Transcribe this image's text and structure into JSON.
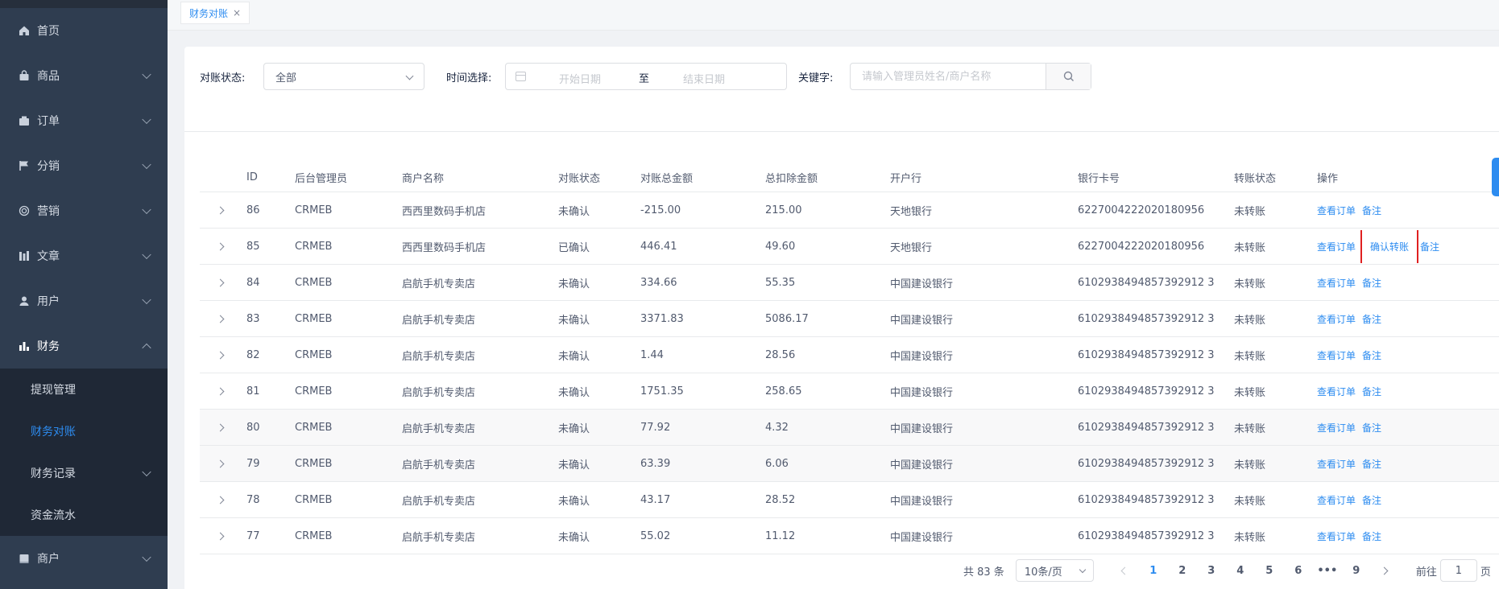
{
  "sidebar": {
    "items": [
      {
        "label": "首页",
        "icon": "home-icon",
        "has_arrow": false
      },
      {
        "label": "商品",
        "icon": "bag-icon",
        "has_arrow": true
      },
      {
        "label": "订单",
        "icon": "order-icon",
        "has_arrow": true
      },
      {
        "label": "分销",
        "icon": "flag-icon",
        "has_arrow": true
      },
      {
        "label": "营销",
        "icon": "target-icon",
        "has_arrow": true
      },
      {
        "label": "文章",
        "icon": "article-icon",
        "has_arrow": true
      },
      {
        "label": "用户",
        "icon": "user-icon",
        "has_arrow": true
      },
      {
        "label": "财务",
        "icon": "bar-chart-icon",
        "has_arrow": true,
        "open": true
      }
    ],
    "submenu": [
      {
        "label": "提现管理"
      },
      {
        "label": "财务对账",
        "active": true
      },
      {
        "label": "财务记录",
        "has_arrow": true
      },
      {
        "label": "资金流水"
      }
    ],
    "after": [
      {
        "label": "商户",
        "icon": "shop-icon",
        "has_arrow": true
      }
    ]
  },
  "tabs": [
    {
      "label": "财务对账",
      "close": "×"
    }
  ],
  "filters": {
    "state_label": "对账状态:",
    "state_value": "全部",
    "time_label": "时间选择:",
    "start_placeholder": "开始日期",
    "range_sep": "至",
    "end_placeholder": "结束日期",
    "keyword_label": "关键字:",
    "keyword_placeholder": "请输入管理员姓名/商户名称"
  },
  "table": {
    "headers": [
      "",
      "ID",
      "后台管理员",
      "商户名称",
      "对账状态",
      "对账总金额",
      "总扣除金额",
      "开户行",
      "银行卡号",
      "转账状态",
      "操作"
    ],
    "rows": [
      {
        "id": "86",
        "admin": "CRMEB",
        "shop": "西西里数码手机店",
        "state": "未确认",
        "total": "-215.00",
        "deduct": "215.00",
        "bank": "天地银行",
        "card": "6227004222020180956",
        "trans": "未转账",
        "ops": [
          "查看订单",
          "备注"
        ]
      },
      {
        "id": "85",
        "admin": "CRMEB",
        "shop": "西西里数码手机店",
        "state": "已确认",
        "total": "446.41",
        "deduct": "49.60",
        "bank": "天地银行",
        "card": "6227004222020180956",
        "trans": "未转账",
        "ops": [
          "查看订单",
          "确认转账",
          "备注"
        ],
        "highlight": 1
      },
      {
        "id": "84",
        "admin": "CRMEB",
        "shop": "启航手机专卖店",
        "state": "未确认",
        "total": "334.66",
        "deduct": "55.35",
        "bank": "中国建设银行",
        "card": "6102938494857392912 3",
        "trans": "未转账",
        "ops": [
          "查看订单",
          "备注"
        ]
      },
      {
        "id": "83",
        "admin": "CRMEB",
        "shop": "启航手机专卖店",
        "state": "未确认",
        "total": "3371.83",
        "deduct": "5086.17",
        "bank": "中国建设银行",
        "card": "6102938494857392912 3",
        "trans": "未转账",
        "ops": [
          "查看订单",
          "备注"
        ]
      },
      {
        "id": "82",
        "admin": "CRMEB",
        "shop": "启航手机专卖店",
        "state": "未确认",
        "total": "1.44",
        "deduct": "28.56",
        "bank": "中国建设银行",
        "card": "6102938494857392912 3",
        "trans": "未转账",
        "ops": [
          "查看订单",
          "备注"
        ]
      },
      {
        "id": "81",
        "admin": "CRMEB",
        "shop": "启航手机专卖店",
        "state": "未确认",
        "total": "1751.35",
        "deduct": "258.65",
        "bank": "中国建设银行",
        "card": "6102938494857392912 3",
        "trans": "未转账",
        "ops": [
          "查看订单",
          "备注"
        ]
      },
      {
        "id": "80",
        "admin": "CRMEB",
        "shop": "启航手机专卖店",
        "state": "未确认",
        "total": "77.92",
        "deduct": "4.32",
        "bank": "中国建设银行",
        "card": "6102938494857392912 3",
        "trans": "未转账",
        "ops": [
          "查看订单",
          "备注"
        ],
        "striped": true
      },
      {
        "id": "79",
        "admin": "CRMEB",
        "shop": "启航手机专卖店",
        "state": "未确认",
        "total": "63.39",
        "deduct": "6.06",
        "bank": "中国建设银行",
        "card": "6102938494857392912 3",
        "trans": "未转账",
        "ops": [
          "查看订单",
          "备注"
        ],
        "striped": true
      },
      {
        "id": "78",
        "admin": "CRMEB",
        "shop": "启航手机专卖店",
        "state": "未确认",
        "total": "43.17",
        "deduct": "28.52",
        "bank": "中国建设银行",
        "card": "6102938494857392912 3",
        "trans": "未转账",
        "ops": [
          "查看订单",
          "备注"
        ]
      },
      {
        "id": "77",
        "admin": "CRMEB",
        "shop": "启航手机专卖店",
        "state": "未确认",
        "total": "55.02",
        "deduct": "11.12",
        "bank": "中国建设银行",
        "card": "6102938494857392912 3",
        "trans": "未转账",
        "ops": [
          "查看订单",
          "备注"
        ]
      }
    ]
  },
  "pager": {
    "total": "共 83 条",
    "size": "10条/页",
    "pages": [
      "1",
      "2",
      "3",
      "4",
      "5",
      "6",
      "•••",
      "9"
    ],
    "current": "1",
    "goto_label": "前往",
    "goto_value": "1",
    "goto_suffix": "页"
  },
  "colors": {
    "accent": "#2d8cf0",
    "sidebar_bg": "#2f3d50",
    "submenu_bg": "#1f2836",
    "highlight_box": "#e02020"
  }
}
